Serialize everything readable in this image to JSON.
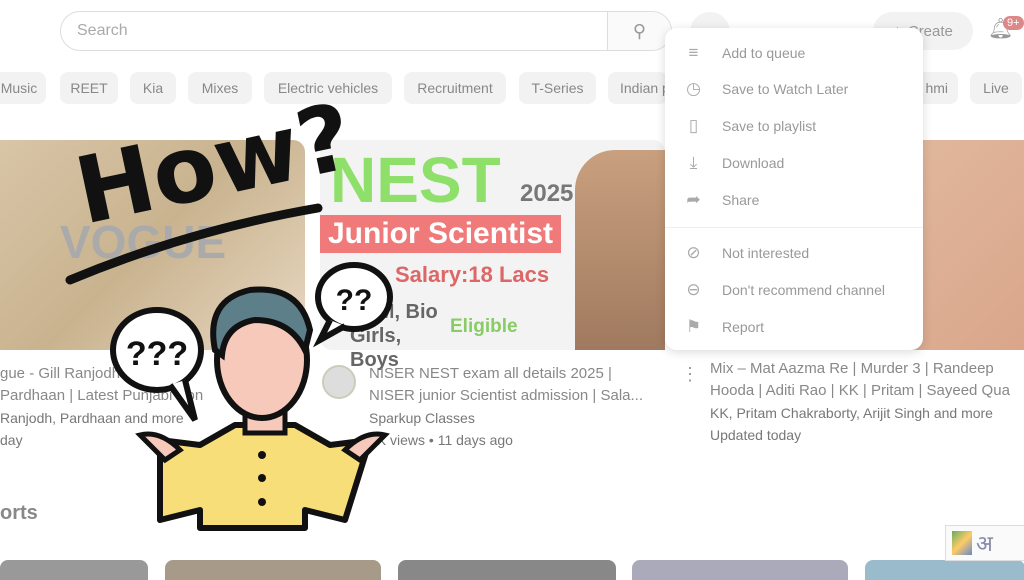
{
  "header": {
    "search_placeholder": "Search",
    "create_label": "Create",
    "notif_badge": "9+"
  },
  "chips": [
    "Music",
    "REET",
    "Kia",
    "Mixes",
    "Electric vehicles",
    "Recruitment",
    "T-Series",
    "Indian pop music",
    "hmi",
    "Live"
  ],
  "videos": [
    {
      "title1": "gue - Gill Ranjodh",
      "title2": "Pardhaan | Latest Punjabi Son",
      "channel": "Ranjodh, Pardhaan and more",
      "stats": "day",
      "thumb_text": "VOGUE"
    },
    {
      "title1": "NISER NEST exam all details 2025 |",
      "title2": "NISER junior Scientist admission | Sala...",
      "channel": "Sparkup Classes",
      "stats": "5K views • 11 days ago",
      "thumb_nest": "NEST",
      "thumb_year": "2025",
      "thumb_junior": "Junior Scientist",
      "thumb_salary": "Salary:18 Lacs",
      "thumb_bio": "PCM, Bio Girls, Boys",
      "thumb_eligible": "Eligible"
    },
    {
      "title1": "Mix – Mat Aazma Re | Murder 3 | Randeep",
      "title2": "Hooda | Aditi Rao | KK | Pritam | Sayeed Qua",
      "channel": "KK, Pritam Chakraborty, Arijit Singh and more",
      "stats": "Updated today"
    }
  ],
  "menu": [
    {
      "icon": "queue-icon",
      "glyph": "≡",
      "label": "Add to queue"
    },
    {
      "icon": "clock-icon",
      "glyph": "◷",
      "label": "Save to Watch Later"
    },
    {
      "icon": "bookmark-icon",
      "glyph": "▯",
      "label": "Save to playlist"
    },
    {
      "icon": "download-icon",
      "glyph": "⤓",
      "label": "Download"
    },
    {
      "icon": "share-icon",
      "glyph": "➦",
      "label": "Share"
    },
    {
      "icon": "block-icon",
      "glyph": "⊘",
      "label": "Not interested"
    },
    {
      "icon": "minus-circle-icon",
      "glyph": "⊖",
      "label": "Don't recommend channel"
    },
    {
      "icon": "flag-icon",
      "glyph": "⚑",
      "label": "Report"
    }
  ],
  "shorts_heading": "orts",
  "overlay": {
    "how_text": "How?",
    "bubble_text": "???",
    "bubble2_text": "??"
  },
  "ime_glyph": "अ"
}
